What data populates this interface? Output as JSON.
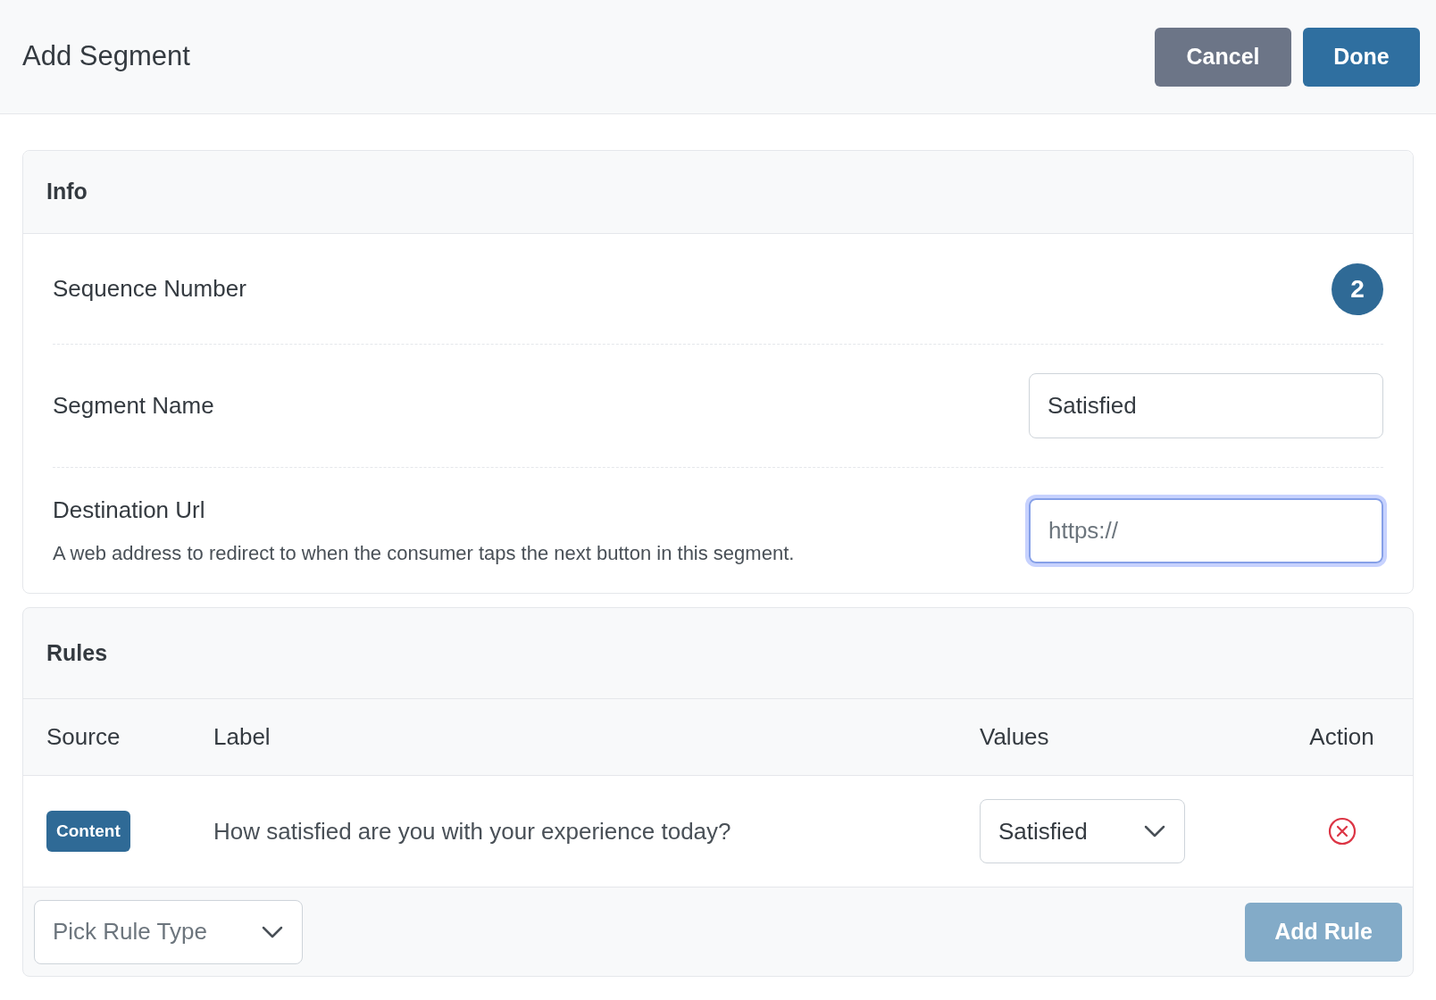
{
  "header": {
    "title": "Add Segment",
    "buttons": [
      {
        "label": "Cancel",
        "kind": "secondary"
      },
      {
        "label": "Done",
        "kind": "primary"
      }
    ]
  },
  "info": {
    "title": "Info",
    "sequence": {
      "label": "Sequence Number",
      "value": "2"
    },
    "segment_name": {
      "label": "Segment Name",
      "value": "Satisfied"
    },
    "destination_url": {
      "label": "Destination Url",
      "description": "A web address to redirect to when the consumer taps the next button in this segment.",
      "placeholder": "https://",
      "focused": true
    }
  },
  "rules": {
    "title": "Rules",
    "columns": [
      "Source",
      "Label",
      "Values",
      "Action"
    ],
    "rows": [
      {
        "source": "Content",
        "label": "How satisfied are you with your experience today?",
        "value": "Satisfied"
      }
    ],
    "rule_type": {
      "placeholder": "Pick Rule Type"
    },
    "add_button": {
      "label": "Add Rule",
      "disabled": true
    }
  }
}
